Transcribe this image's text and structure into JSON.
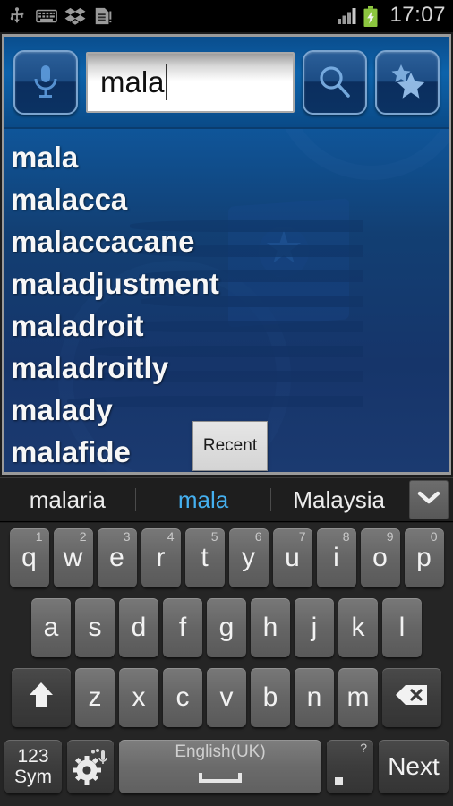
{
  "statusbar": {
    "icons": [
      "usb-icon",
      "keyboard-icon",
      "dropbox-icon",
      "sdcard-icon",
      "signal-icon",
      "battery-charging-icon"
    ],
    "time": "17:07"
  },
  "app": {
    "search": {
      "voice_button": "mic-icon",
      "input_value": "mala",
      "input_placeholder": "",
      "search_button": "search-icon",
      "favorites_button": "star-icon"
    },
    "words": [
      "mala",
      "malacca",
      "malaccacane",
      "maladjustment",
      "maladroit",
      "maladroitly",
      "malady",
      "malafide"
    ],
    "recent_button": "Recent"
  },
  "suggestions": {
    "items": [
      {
        "text": "malaria",
        "highlighted": false
      },
      {
        "text": "mala",
        "highlighted": true
      },
      {
        "text": "Malaysia",
        "highlighted": false
      }
    ],
    "expand_button": "chevron-down-icon"
  },
  "keyboard": {
    "row1": [
      {
        "label": "q",
        "sup": "1"
      },
      {
        "label": "w",
        "sup": "2"
      },
      {
        "label": "e",
        "sup": "3"
      },
      {
        "label": "r",
        "sup": "4"
      },
      {
        "label": "t",
        "sup": "5"
      },
      {
        "label": "y",
        "sup": "6"
      },
      {
        "label": "u",
        "sup": "7"
      },
      {
        "label": "i",
        "sup": "8"
      },
      {
        "label": "o",
        "sup": "9"
      },
      {
        "label": "p",
        "sup": "0"
      }
    ],
    "row2": [
      {
        "label": "a"
      },
      {
        "label": "s"
      },
      {
        "label": "d"
      },
      {
        "label": "f"
      },
      {
        "label": "g"
      },
      {
        "label": "h"
      },
      {
        "label": "j"
      },
      {
        "label": "k"
      },
      {
        "label": "l"
      }
    ],
    "row3": [
      {
        "label": "z"
      },
      {
        "label": "x"
      },
      {
        "label": "c"
      },
      {
        "label": "v"
      },
      {
        "label": "b"
      },
      {
        "label": "n"
      },
      {
        "label": "m"
      }
    ],
    "shift": "shift-icon",
    "backspace": "backspace-icon",
    "sym_line1": "123",
    "sym_line2": "Sym",
    "settings": "gear-mic-icon",
    "space_label": "English(UK)",
    "period_sup": "?",
    "period_label": ".",
    "next_label": "Next"
  },
  "colors": {
    "app_blue": "#0d5ba3",
    "suggestion_highlight": "#45b0f0",
    "battery_green": "#8cc63f",
    "key_face": "#656565",
    "key_dark": "#3c3c3c"
  }
}
